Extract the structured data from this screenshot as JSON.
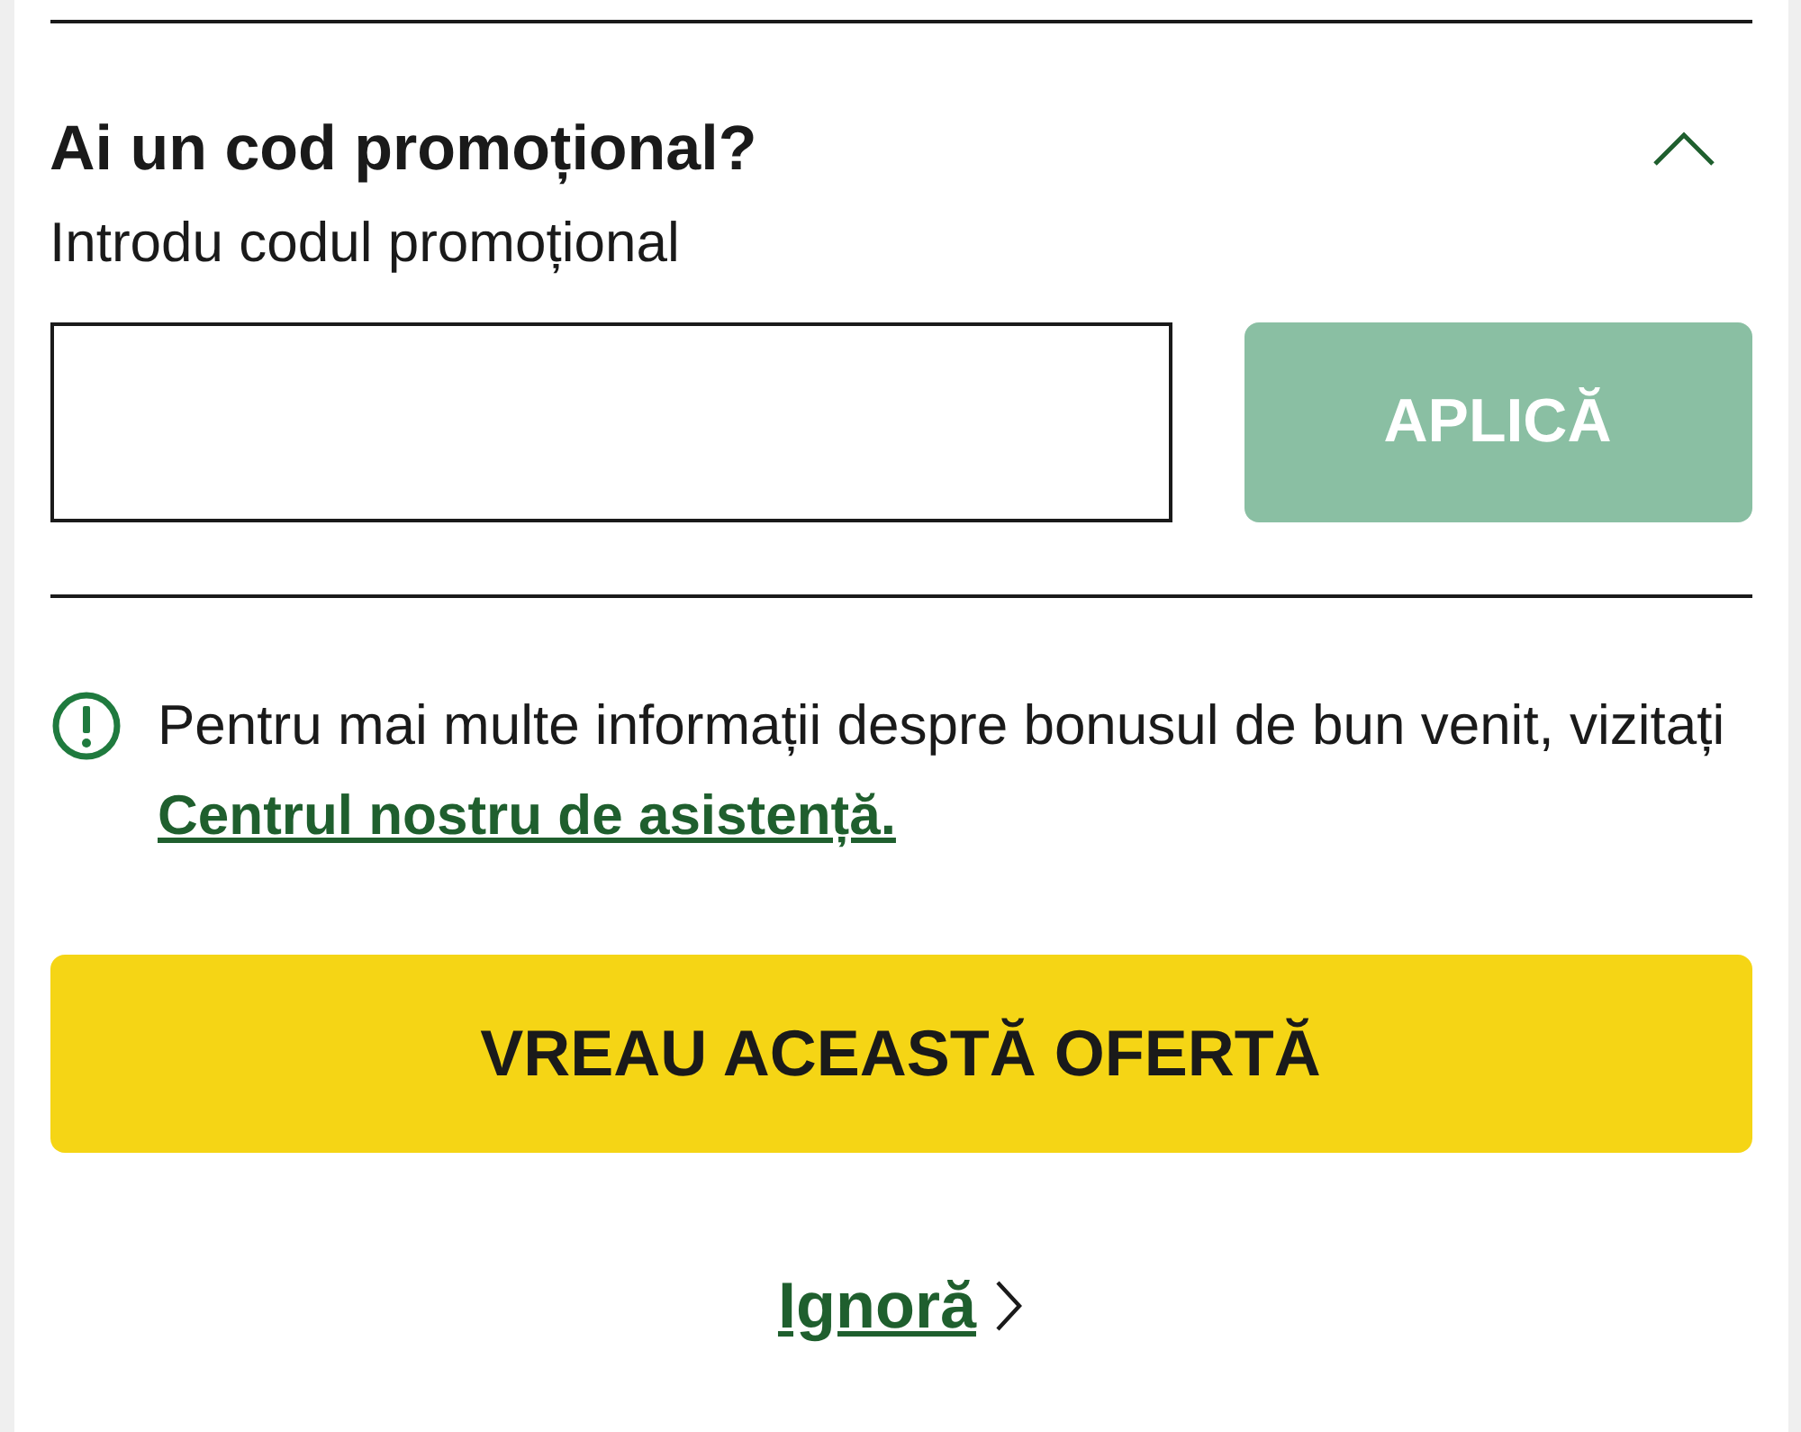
{
  "promo": {
    "title": "Ai un cod promoțional?",
    "expanded": true,
    "label": "Introdu codul promoțional",
    "apply_button": {
      "label": "APLICĂ",
      "disabled": true
    }
  },
  "info": {
    "text": "Pentru mai multe informații despre bonusul de bun venit, vizitați",
    "link": "Centrul nostru de asistență."
  },
  "primary_button": "VREAU ACEASTĂ OFERTĂ",
  "skip_link": "Ignoră"
}
